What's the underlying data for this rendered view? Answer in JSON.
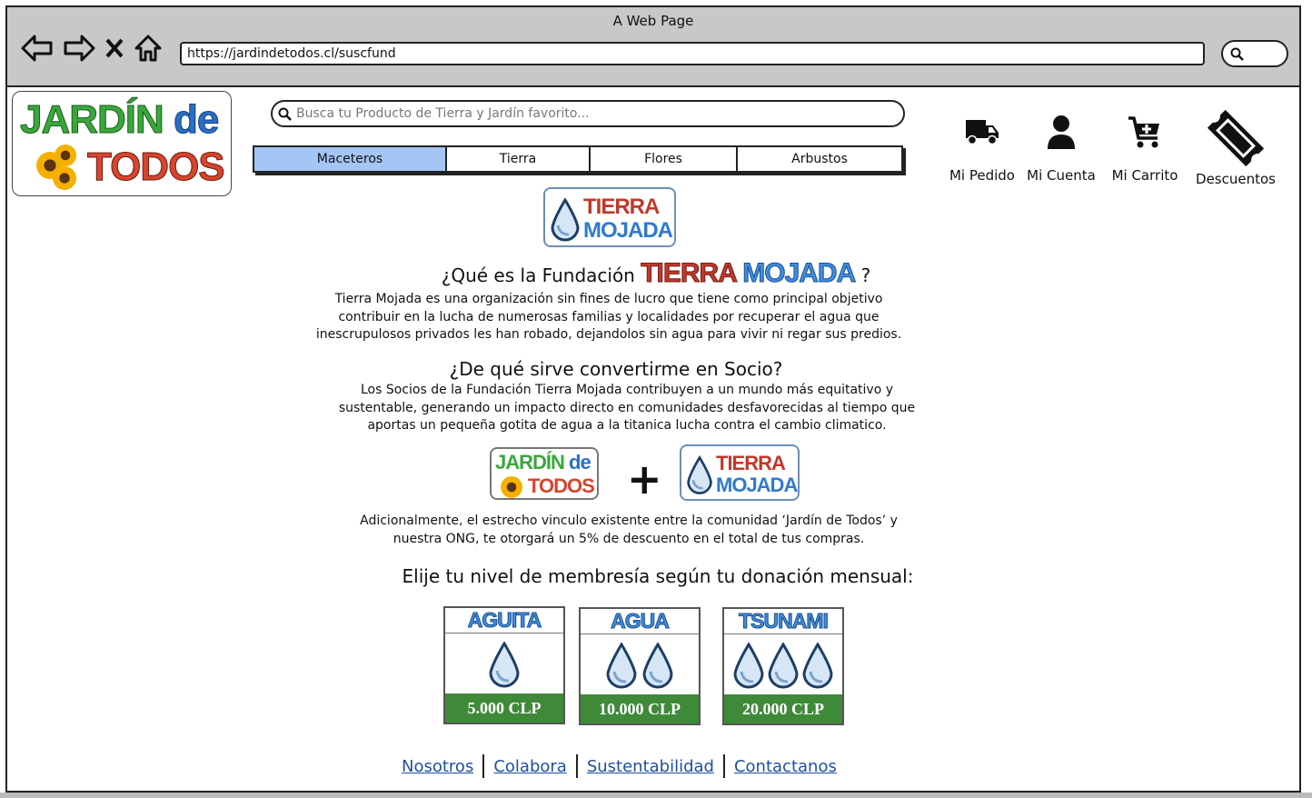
{
  "browser": {
    "window_title": "A Web Page",
    "url": "https://jardindetodos.cl/suscfund"
  },
  "logo": {
    "line1_a": "JARDÍN",
    "line1_b": "de",
    "line2": "TODOS"
  },
  "search": {
    "placeholder": "Busca tu Producto de Tierra y Jardín favorito..."
  },
  "tabs": [
    {
      "label": "Maceteros",
      "active": true
    },
    {
      "label": "Tierra",
      "active": false
    },
    {
      "label": "Flores",
      "active": false
    },
    {
      "label": "Arbustos",
      "active": false
    }
  ],
  "header_actions": {
    "order": "Mi Pedido",
    "account": "Mi Cuenta",
    "cart": "Mi Carrito",
    "discounts": "Descuentos"
  },
  "tm_logo": {
    "word1": "TIERRA",
    "word2": "MOJADA"
  },
  "section1": {
    "heading_prefix": "¿Qué es la Fundación",
    "heading_word1": "TIERRA",
    "heading_word2": "MOJADA",
    "heading_suffix": "?",
    "lines": [
      "Tierra Mojada es una organización sin fines de lucro que tiene como principal objetivo",
      "contribuir en la lucha de numerosas familias y localidades por recuperar el agua que",
      "inescrupulosos privados les han robado, dejandolos sin agua para vivir ni regar sus predios."
    ]
  },
  "section2": {
    "heading": "¿De qué sirve convertirme en Socio?",
    "lines": [
      "Los Socios de la Fundación Tierra Mojada contribuyen a un mundo más equitativo y",
      "sustentable, generando un impacto directo en comunidades desfavorecidas al tiempo que",
      "aportas un pequeña gotita de agua a la titanica lucha contra el cambio climatico."
    ]
  },
  "partnership": {
    "plus": "+",
    "lines": [
      "Adicionalmente, el estrecho vinculo existente entre la comunidad ‘Jardín de Todos’ y",
      "nuestra ONG, te otorgará un 5% de descuento en el total de tus compras."
    ]
  },
  "membership": {
    "heading": "Elije tu nivel de membresía según tu donación mensual:",
    "tiers": [
      {
        "name": "AGUITA",
        "price": "5.000 CLP",
        "drops": 1
      },
      {
        "name": "AGUA",
        "price": "10.000 CLP",
        "drops": 2
      },
      {
        "name": "TSUNAMI",
        "price": "20.000 CLP",
        "drops": 3
      }
    ]
  },
  "footer": {
    "links": [
      "Nosotros",
      "Colabora",
      "Sustentabilidad",
      "Contactanos"
    ]
  },
  "colors": {
    "active_tab": "#a4c6f4",
    "price_band": "#3f8a39",
    "tierra_red": "#c0392b",
    "mojada_blue": "#3e8ee0",
    "link_blue": "#1f4fa0"
  }
}
